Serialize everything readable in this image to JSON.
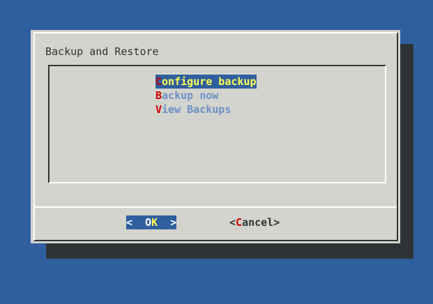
{
  "dialog": {
    "title": "Backup and Restore",
    "menu": [
      {
        "hotkey": "C",
        "rest": "onfigure backup",
        "selected": true
      },
      {
        "hotkey": "B",
        "rest": "ackup now",
        "selected": false
      },
      {
        "hotkey": "V",
        "rest": "iew Backups",
        "selected": false
      }
    ],
    "buttons": {
      "ok": {
        "left": "<  ",
        "pre": "O",
        "hotkey": "K",
        "right": "  >"
      },
      "cancel": {
        "left": "<",
        "hotkey": "C",
        "rest": "ancel",
        "right": ">"
      }
    }
  },
  "colors": {
    "desktop": "#2f5f9f",
    "dialog": "#d4d4ce",
    "shadow": "#2e3436",
    "hotkey": "#cc0000",
    "highlight_text": "#ffff55",
    "item_text": "#6b8fc7"
  }
}
